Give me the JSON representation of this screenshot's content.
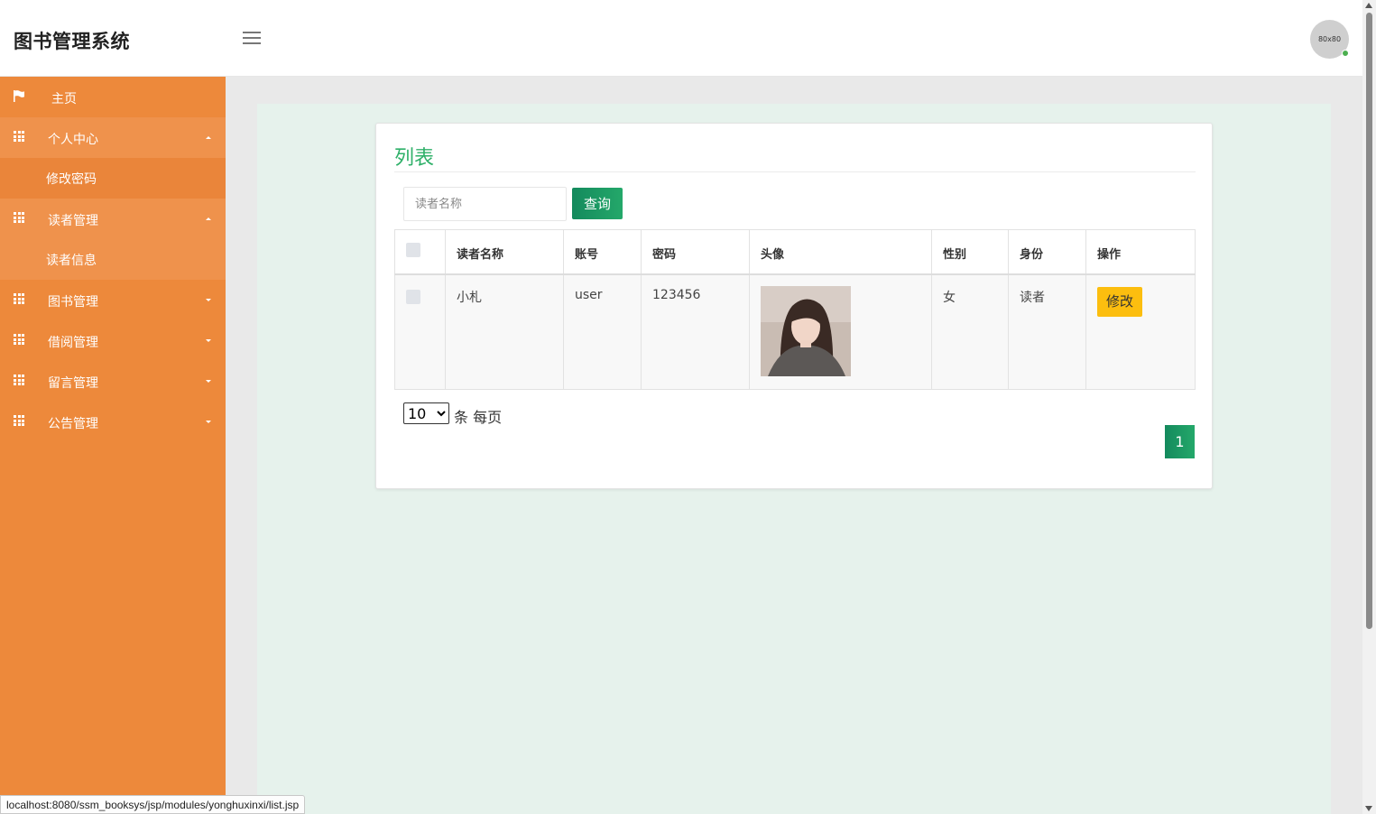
{
  "header": {
    "title": "图书管理系统",
    "avatar_text": "80x80"
  },
  "sidebar": {
    "home": "主页",
    "groups": [
      {
        "label": "个人中心",
        "expanded": true,
        "items": [
          "修改密码"
        ]
      },
      {
        "label": "读者管理",
        "expanded": true,
        "items": [
          "读者信息"
        ]
      },
      {
        "label": "图书管理",
        "expanded": false
      },
      {
        "label": "借阅管理",
        "expanded": false
      },
      {
        "label": "留言管理",
        "expanded": false
      },
      {
        "label": "公告管理",
        "expanded": false
      }
    ]
  },
  "panel": {
    "title": "列表",
    "search_placeholder": "读者名称",
    "search_button": "查询",
    "table": {
      "columns": [
        "读者名称",
        "账号",
        "密码",
        "头像",
        "性别",
        "身份",
        "操作"
      ],
      "rows": [
        {
          "name": "小札",
          "account": "user",
          "password": "123456",
          "gender": "女",
          "role": "读者",
          "action": "修改"
        }
      ]
    },
    "page_size": "10",
    "page_size_label": "条 每页",
    "current_page": "1"
  },
  "status_url": "localhost:8080/ssm_booksys/jsp/modules/yonghuxinxi/list.jsp",
  "colors": {
    "sidebar": "#ed893b",
    "accent_green": "#2fb069",
    "button_green": "#148a5d",
    "edit_yellow": "#fcbe0f"
  }
}
